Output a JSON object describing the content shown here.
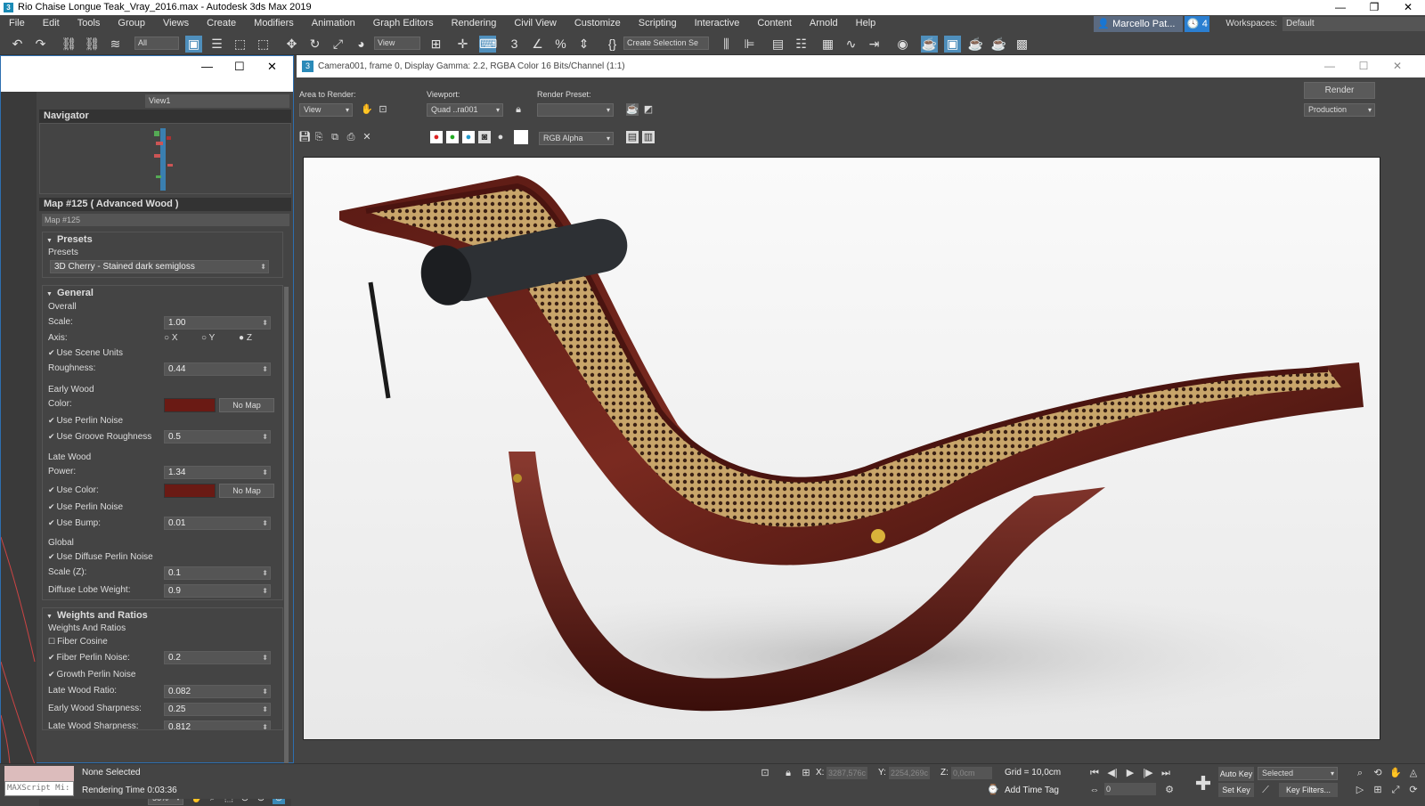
{
  "window": {
    "title": "Rio Chaise Longue Teak_Vray_2016.max - Autodesk 3ds Max 2019",
    "app_icon": "3"
  },
  "menu": [
    "File",
    "Edit",
    "Tools",
    "Group",
    "Views",
    "Create",
    "Modifiers",
    "Animation",
    "Graph Editors",
    "Rendering",
    "Civil View",
    "Customize",
    "Scripting",
    "Interactive",
    "Content",
    "Arnold",
    "Help"
  ],
  "user": {
    "name": "Marcello Pat...",
    "badge": "4",
    "workspaces_label": "Workspaces:",
    "workspace": "Default"
  },
  "toolbar": {
    "filter": "All",
    "ref_coord": "View",
    "selection_set": "Create Selection Se"
  },
  "left": {
    "view_select": "View1",
    "navigator_title": "Navigator",
    "map_title": "Map #125  ( Advanced Wood )",
    "map_name": "Map #125",
    "presets": {
      "header": "Presets",
      "label": "Presets",
      "value": "3D Cherry - Stained dark semigloss"
    },
    "general": {
      "header": "General",
      "overall": "Overall",
      "scale_label": "Scale:",
      "scale": "1.00",
      "axis_label": "Axis:",
      "axis_x": "X",
      "axis_y": "Y",
      "axis_z": "Z",
      "use_scene_units": "Use Scene Units",
      "roughness_label": "Roughness:",
      "roughness": "0.44",
      "early_wood": "Early Wood",
      "color_label": "Color:",
      "no_map": "No Map",
      "use_perlin": "Use Perlin Noise",
      "use_groove": "Use Groove Roughness",
      "groove": "0.5",
      "late_wood": "Late Wood",
      "power_label": "Power:",
      "power": "1.34",
      "use_color": "Use Color:",
      "no_map2": "No Map",
      "use_perlin2": "Use Perlin Noise",
      "use_bump": "Use Bump:",
      "bump": "0.01",
      "global": "Global",
      "use_diffuse": "Use Diffuse Perlin Noise",
      "scale_z_label": "Scale (Z):",
      "scale_z": "0.1",
      "diffuse_label": "Diffuse Lobe Weight:",
      "diffuse": "0.9"
    },
    "weights": {
      "header": "Weights and Ratios",
      "sub": "Weights And Ratios",
      "fiber_cosine": "Fiber Cosine",
      "fiber_perlin": "Fiber Perlin Noise:",
      "fiber_perlin_val": "0.2",
      "growth": "Growth Perlin Noise",
      "late_ratio": "Late Wood Ratio:",
      "late_ratio_val": "0.082",
      "early_sharp": "Early Wood Sharpness:",
      "early_sharp_val": "0.25",
      "late_sharp": "Late Wood Sharpness:",
      "late_sharp_val": "0.812"
    },
    "zoom": "56%"
  },
  "render": {
    "title": "Camera001, frame 0, Display Gamma: 2.2, RGBA Color 16 Bits/Channel (1:1)",
    "area_label": "Area to Render:",
    "area": "View",
    "viewport_label": "Viewport:",
    "viewport": "Quad ..ra001",
    "preset_label": "Render Preset:",
    "preset": "",
    "render_btn": "Render",
    "production": "Production",
    "channel": "RGB Alpha"
  },
  "status": {
    "maxscript": "MAXScript Mi:",
    "selection": "None Selected",
    "rendering_time": "Rendering Time  0:03:36",
    "x_label": "X:",
    "x": "3287,576c",
    "y_label": "Y:",
    "y": "2254,269c",
    "z_label": "Z:",
    "z": "0,0cm",
    "grid": "Grid = 10,0cm",
    "add_time_tag": "Add Time Tag",
    "auto_key": "Auto Key",
    "selected": "Selected",
    "set_key": "Set Key",
    "key_filters": "Key Filters...",
    "frame": "0"
  }
}
